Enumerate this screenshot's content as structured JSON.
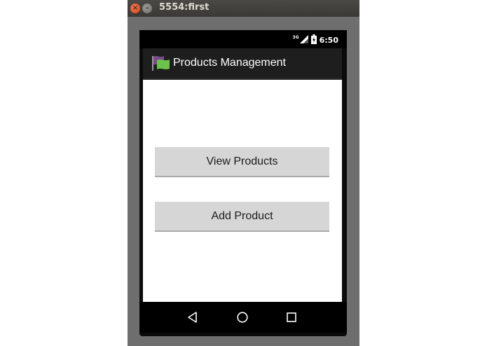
{
  "window": {
    "title": "5554:first",
    "close_glyph": "×",
    "minimize_glyph": "–"
  },
  "status_bar": {
    "network_type": "3G",
    "time": "6:50",
    "icons": [
      "signal-icon",
      "battery-icon"
    ]
  },
  "action_bar": {
    "app_icon": "app-flag-icon",
    "title": "Products Management"
  },
  "main": {
    "view_products_label": "View Products",
    "add_product_label": "Add Product"
  },
  "nav_bar": {
    "icons": [
      "back-icon",
      "home-icon",
      "recent-apps-icon"
    ]
  },
  "colors": {
    "window_background": "#6e6e6e",
    "action_bar": "#1e1e1e",
    "button_background": "#d6d6d6",
    "content_background": "#ffffff",
    "app_icon_green": "#6cc24a",
    "app_icon_purple": "#7a4a8c"
  }
}
